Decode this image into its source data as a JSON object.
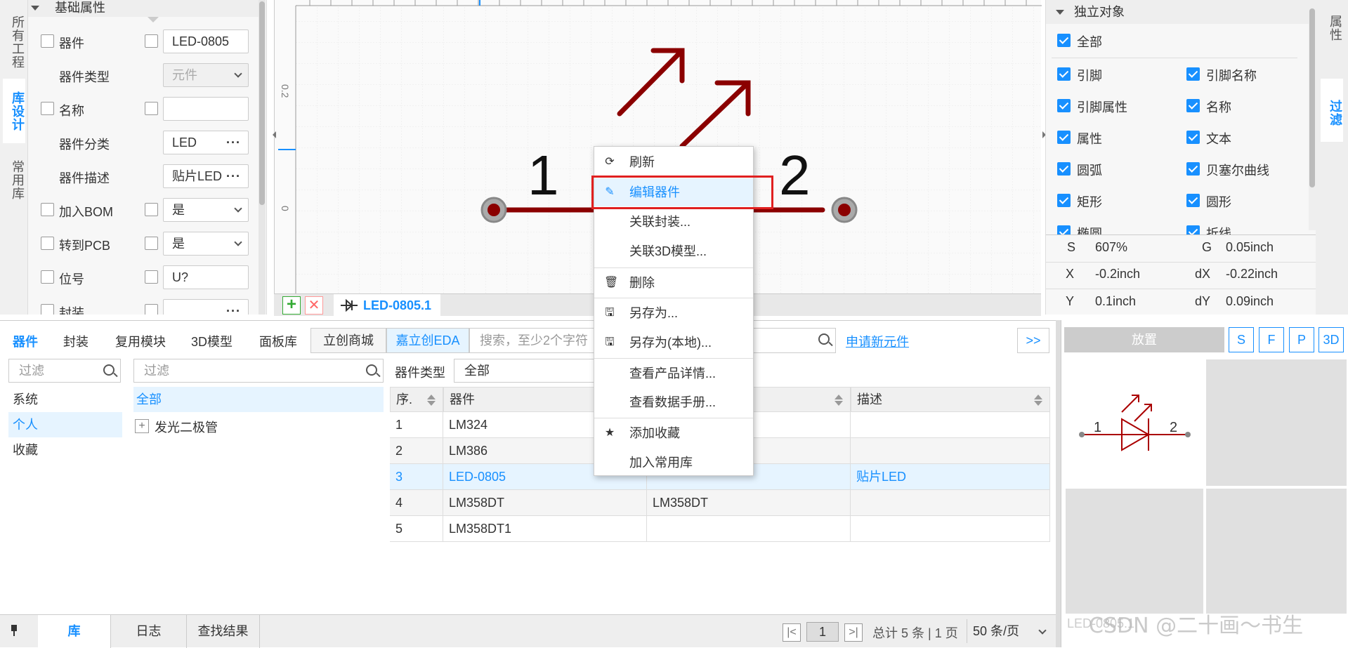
{
  "left_vtabs": [
    "所有工程",
    "库设计",
    "常用库"
  ],
  "props": {
    "section_title": "基础属性",
    "rows": [
      {
        "label": "器件",
        "value": "LED-0805",
        "cb_label": true,
        "cb_value": true,
        "kind": "text"
      },
      {
        "label": "器件类型",
        "value": "元件",
        "kind": "select-disabled"
      },
      {
        "label": "名称",
        "value": "",
        "cb_label": true,
        "cb_value": true,
        "kind": "text"
      },
      {
        "label": "器件分类",
        "value": "LED",
        "kind": "dots"
      },
      {
        "label": "器件描述",
        "value": "贴片LED",
        "kind": "dots"
      },
      {
        "label": "加入BOM",
        "value": "是",
        "cb_label": true,
        "cb_value": true,
        "kind": "select"
      },
      {
        "label": "转到PCB",
        "value": "是",
        "cb_label": true,
        "cb_value": true,
        "kind": "select"
      },
      {
        "label": "位号",
        "value": "U?",
        "cb_label": true,
        "cb_value": true,
        "kind": "text"
      },
      {
        "label": "封装",
        "value": "",
        "cb_label": true,
        "cb_value": true,
        "kind": "dots"
      }
    ]
  },
  "canvas": {
    "ruler_labels": [
      "0.2",
      "0"
    ],
    "pin_numbers": [
      "1",
      "2"
    ],
    "doc_tab": "LED-0805.1",
    "colors": {
      "body": "#8b0000",
      "pin": "#8b0000",
      "pin_end": "#888888"
    }
  },
  "filter_panel": {
    "title": "独立对象",
    "all_label": "全部",
    "items": [
      [
        "引脚",
        "引脚名称"
      ],
      [
        "引脚属性",
        "名称"
      ],
      [
        "属性",
        "文本"
      ],
      [
        "圆弧",
        "贝塞尔曲线"
      ],
      [
        "矩形",
        "圆形"
      ],
      [
        "椭圆",
        "折线"
      ]
    ]
  },
  "right_vtabs": [
    "属性",
    "过滤"
  ],
  "stats": {
    "s_label": "S",
    "s_value": "607%",
    "g_label": "G",
    "g_value": "0.05inch",
    "x_label": "X",
    "x_value": "-0.2inch",
    "dx_label": "dX",
    "dx_value": "-0.22inch",
    "y_label": "Y",
    "y_value": "0.1inch",
    "dy_label": "dY",
    "dy_value": "0.09inch"
  },
  "library": {
    "tabs": [
      "器件",
      "封装",
      "复用模块",
      "3D模型",
      "面板库"
    ],
    "store_btn": "立创商城",
    "eda_btn": "嘉立创EDA",
    "search_placeholder": "搜索，至少2个字符",
    "apply_link": "申请新元件",
    "expand_btn": ">>",
    "filter_placeholder": "过滤",
    "categories": [
      "系统",
      "个人",
      "收藏"
    ],
    "tree_all": "全部",
    "tree_node": "发光二极管",
    "type_label": "器件类型",
    "type_value": "全部",
    "columns": [
      "序.",
      "器件",
      "",
      "描述"
    ],
    "rows": [
      [
        "1",
        "LM324",
        "",
        ""
      ],
      [
        "2",
        "LM386",
        "",
        ""
      ],
      [
        "3",
        "LED-0805",
        "",
        "贴片LED"
      ],
      [
        "4",
        "LM358DT",
        "LM358DT",
        ""
      ],
      [
        "5",
        "LM358DT1",
        "",
        ""
      ]
    ]
  },
  "preview": {
    "place_btn": "放置",
    "buttons": [
      "S",
      "F",
      "P",
      "3D"
    ],
    "pin1": "1",
    "pin2": "2",
    "bottom_label": "LED-0805.1"
  },
  "statusbar": {
    "tabs": [
      "库",
      "日志",
      "查找结果"
    ],
    "page": "1",
    "total": "总计 5 条 | 1 页",
    "per_page": "50 条/页"
  },
  "context_menu": {
    "items": [
      {
        "label": "刷新",
        "icon": "refresh-icon"
      },
      {
        "label": "编辑器件",
        "icon": "pencil-icon"
      },
      {
        "label": "关联封装...",
        "icon": ""
      },
      {
        "label": "关联3D模型...",
        "icon": ""
      },
      {
        "label": "删除",
        "icon": "trash-icon"
      },
      {
        "label": "另存为...",
        "icon": "save-icon"
      },
      {
        "label": "另存为(本地)...",
        "icon": "save-icon"
      },
      {
        "label": "查看产品详情...",
        "icon": ""
      },
      {
        "label": "查看数据手册...",
        "icon": ""
      },
      {
        "label": "添加收藏",
        "icon": "star-icon"
      },
      {
        "label": "加入常用库",
        "icon": ""
      }
    ]
  },
  "watermark": "CSDN @二十画～书生"
}
